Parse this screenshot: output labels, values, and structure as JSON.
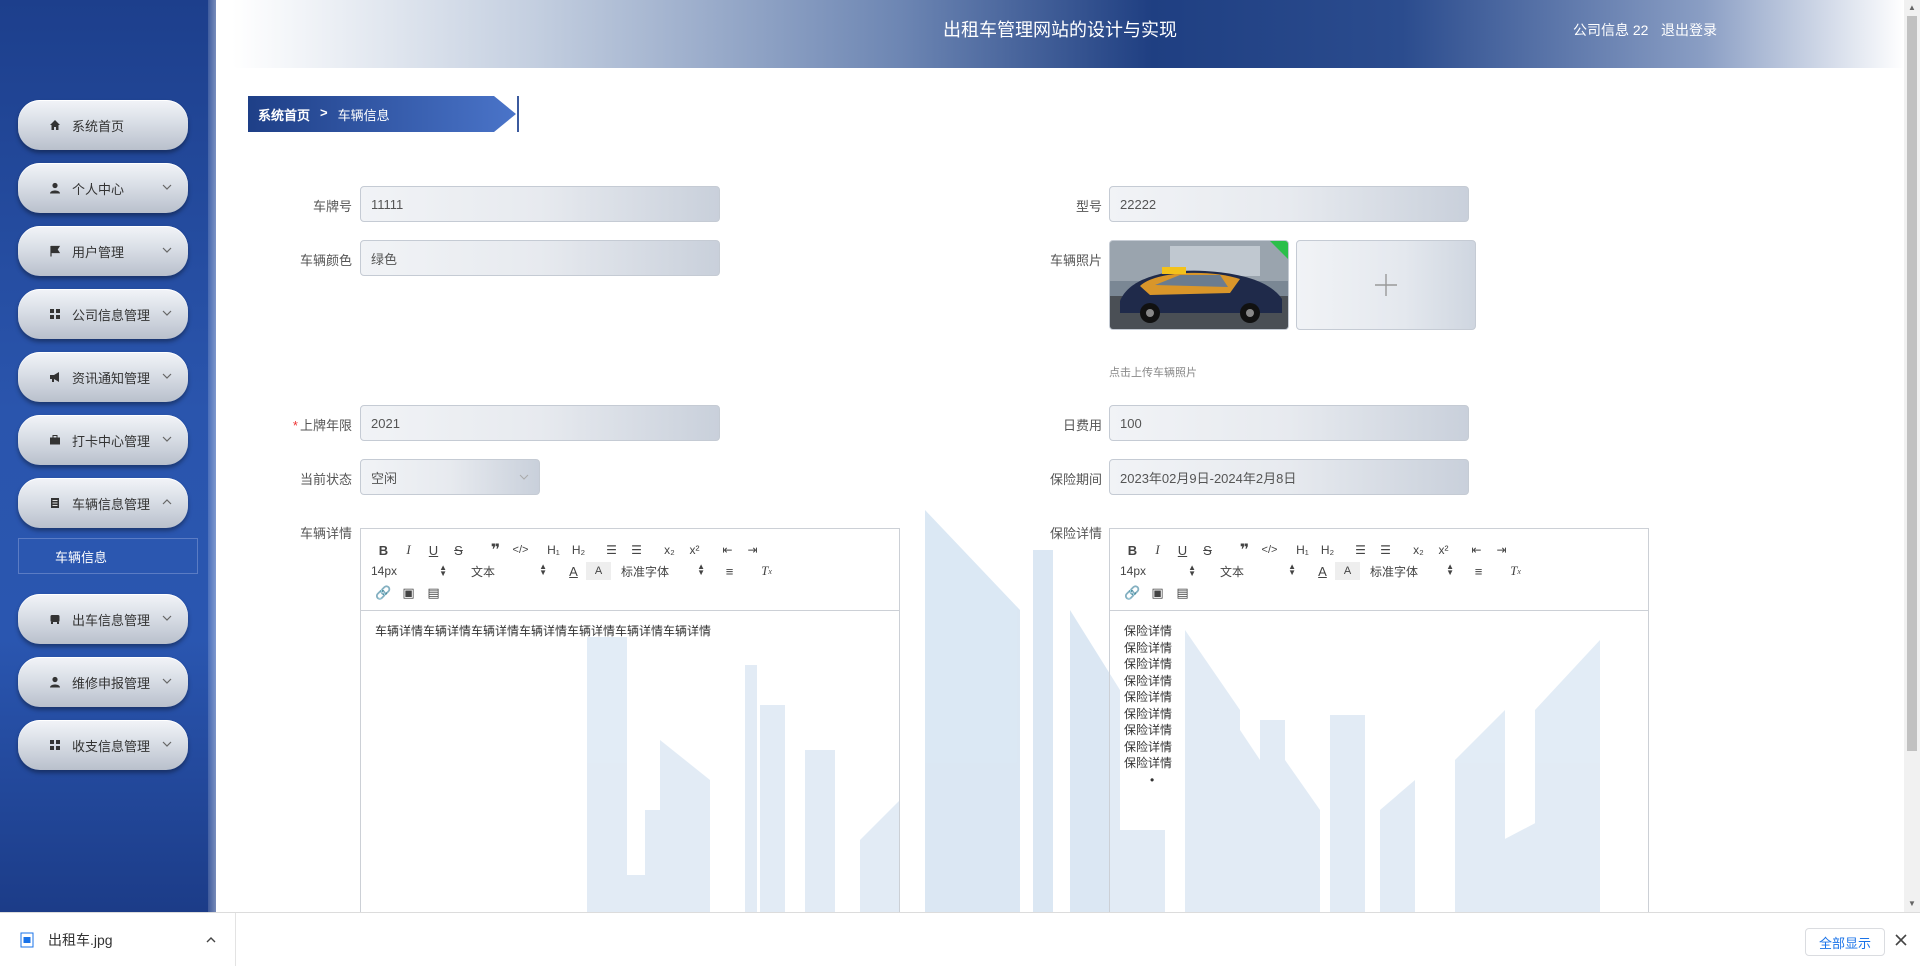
{
  "app": {
    "title": "出租车管理网站的设计与实现",
    "user": "公司信息 22",
    "logout": "退出登录"
  },
  "sidebar": {
    "items": [
      {
        "label": "系统首页",
        "icon": "home-icon"
      },
      {
        "label": "个人中心",
        "icon": "user-icon"
      },
      {
        "label": "用户管理",
        "icon": "flag-icon"
      },
      {
        "label": "公司信息管理",
        "icon": "grid-icon"
      },
      {
        "label": "资讯通知管理",
        "icon": "megaphone-icon"
      },
      {
        "label": "打卡中心管理",
        "icon": "briefcase-icon"
      },
      {
        "label": "车辆信息管理",
        "icon": "document-icon"
      },
      {
        "label": "出车信息管理",
        "icon": "car-icon"
      },
      {
        "label": "维修申报管理",
        "icon": "user-icon"
      },
      {
        "label": "收支信息管理",
        "icon": "grid-icon"
      }
    ],
    "active_sub": "车辆信息"
  },
  "breadcrumb": {
    "home": "系统首页",
    "separator": ">",
    "current": "车辆信息"
  },
  "form": {
    "plate_label": "车牌号",
    "plate_value": "11111",
    "model_label": "型号",
    "model_value": "22222",
    "color_label": "车辆颜色",
    "color_value": "绿色",
    "photo_label": "车辆照片",
    "upload_tip": "点击上传车辆照片",
    "year_label": "上牌年限",
    "year_value": "2021",
    "fee_label": "日费用",
    "fee_value": "100",
    "status_label": "当前状态",
    "status_value": "空闲",
    "insurance_period_label": "保险期间",
    "insurance_period_value": "2023年02月9日-2024年2月8日",
    "detail_label": "车辆详情",
    "detail_content": "车辆详情车辆详情车辆详情车辆详情车辆详情车辆详情车辆详情",
    "insurance_detail_label": "保险详情",
    "insurance_lines": [
      "保险详情",
      "保险详情",
      "保险详情",
      "保险详情",
      "保险详情",
      "保险详情",
      "保险详情",
      "保险详情",
      "保险详情"
    ]
  },
  "editor": {
    "font_size": "14px",
    "text_type": "文本",
    "font_family": "标准字体"
  },
  "download": {
    "filename": "出租车.jpg",
    "show_all": "全部显示"
  },
  "colors": {
    "sidebar": "#2a55ad",
    "header_dark": "#1f3f82",
    "breadcrumb": "#2d55a8",
    "required": "#e33333",
    "link_blue": "#1a73e8"
  }
}
